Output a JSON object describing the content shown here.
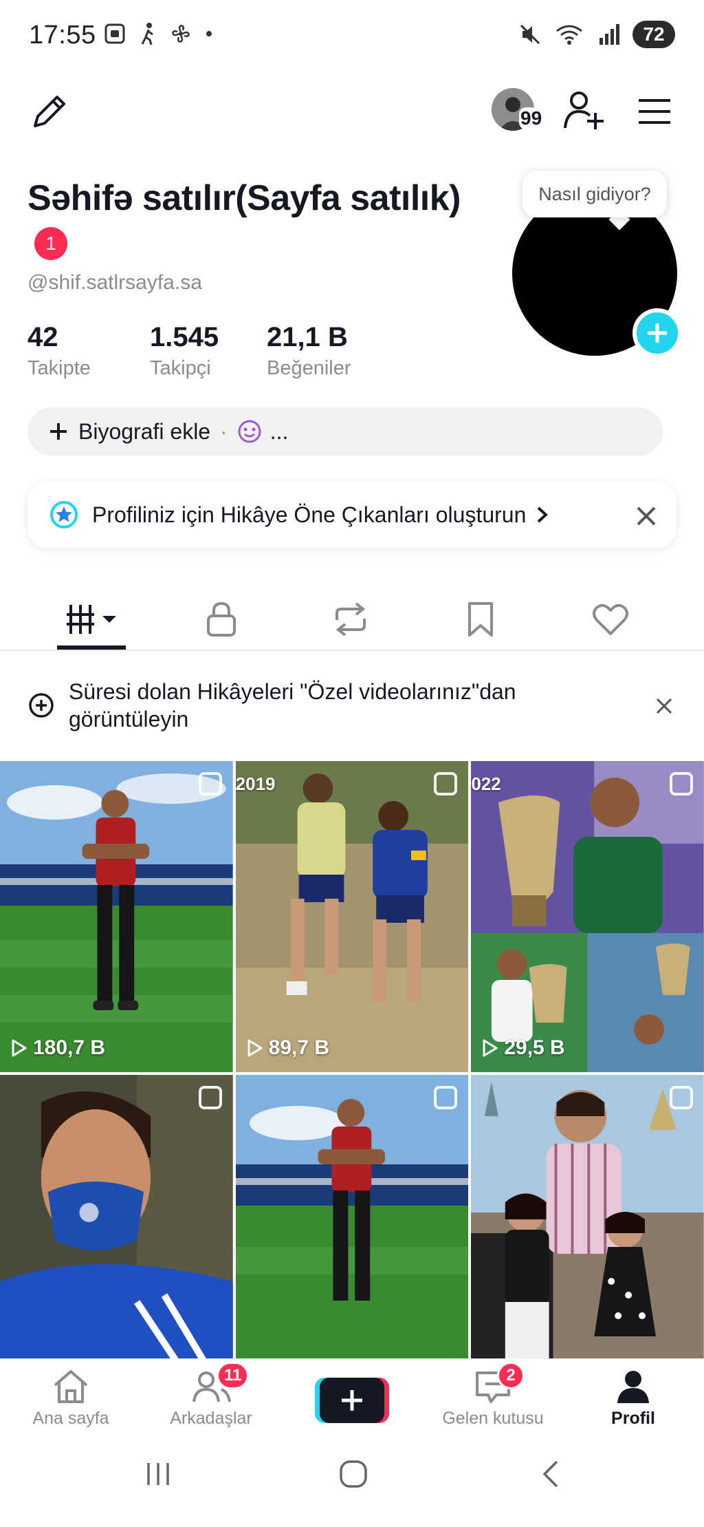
{
  "status_bar": {
    "time": "17:55",
    "battery": "72"
  },
  "header": {
    "notification_count": "99"
  },
  "profile": {
    "name": "Səhifə satılır(Sayfa satılık)",
    "badge_count": "1",
    "username": "@shif.satlrsayfa.sa",
    "tooltip": "Nasıl gidiyor?",
    "stats": [
      {
        "value": "42",
        "label": "Takipte"
      },
      {
        "value": "1.545",
        "label": "Takipçi"
      },
      {
        "value": "21,1 B",
        "label": "Beğeniler"
      }
    ],
    "bio_button": "Biyografi ekle",
    "bio_separator": "·",
    "bio_more": "..."
  },
  "highlight_card": {
    "text": "Profiliniz için Hikâye Öne Çıkanları oluşturun"
  },
  "expired_banner": {
    "text": "Süresi dolan Hikâyeleri \"Özel videolarınız\"dan görüntüleyin"
  },
  "videos": [
    {
      "views": "180,7 B",
      "year": ""
    },
    {
      "views": "89,7 B",
      "year": "2019"
    },
    {
      "views": "29,5 B",
      "year": "022"
    },
    {
      "views": "",
      "year": ""
    },
    {
      "views": "",
      "year": ""
    },
    {
      "views": "",
      "year": ""
    }
  ],
  "bottom_nav": {
    "home": "Ana sayfa",
    "friends": "Arkadaşlar",
    "friends_badge": "11",
    "inbox": "Gelen kutusu",
    "inbox_badge": "2",
    "profile": "Profil"
  },
  "colors": {
    "accent_red": "#fe2c55",
    "accent_cyan": "#20d5ec",
    "text_primary": "#161823",
    "text_secondary": "#8a8b91"
  }
}
